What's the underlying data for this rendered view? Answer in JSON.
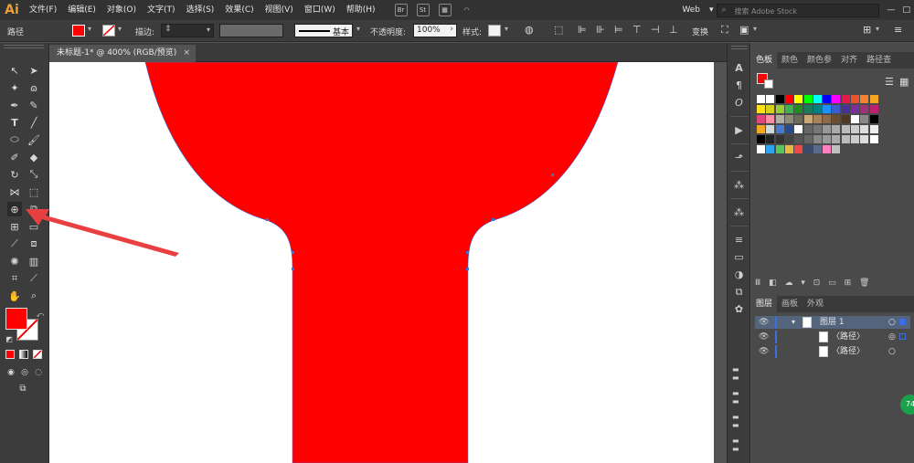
{
  "menubar": {
    "logo": "Ai",
    "items": [
      "文件(F)",
      "编辑(E)",
      "对象(O)",
      "文字(T)",
      "选择(S)",
      "效果(C)",
      "视图(V)",
      "窗口(W)",
      "帮助(H)"
    ],
    "bridge": "Br",
    "stock": "St",
    "workspace": "Web",
    "search_placeholder": "搜索 Adobe Stock"
  },
  "controlbar": {
    "selection_type": "路径",
    "stroke_label": "描边:",
    "brush_label": "基本",
    "opacity_label": "不透明度:",
    "opacity_value": "100%",
    "style_label": "样式:",
    "transform_label": "变换"
  },
  "document": {
    "tab_title": "未标题-1* @ 400% (RGB/预览)",
    "close": "×"
  },
  "panels": {
    "color_tabs": [
      "色板",
      "颜色",
      "颜色参",
      "对齐",
      "路径查"
    ],
    "layer_tabs": [
      "图层",
      "画板",
      "外观"
    ],
    "layers": [
      {
        "name": "图层 1"
      },
      {
        "name": "〈路径〉"
      },
      {
        "name": "〈路径〉"
      }
    ]
  },
  "colors": {
    "fill": "#ff0000",
    "shape": "#ff0000",
    "arrow": "#e84040"
  },
  "badge": "74"
}
